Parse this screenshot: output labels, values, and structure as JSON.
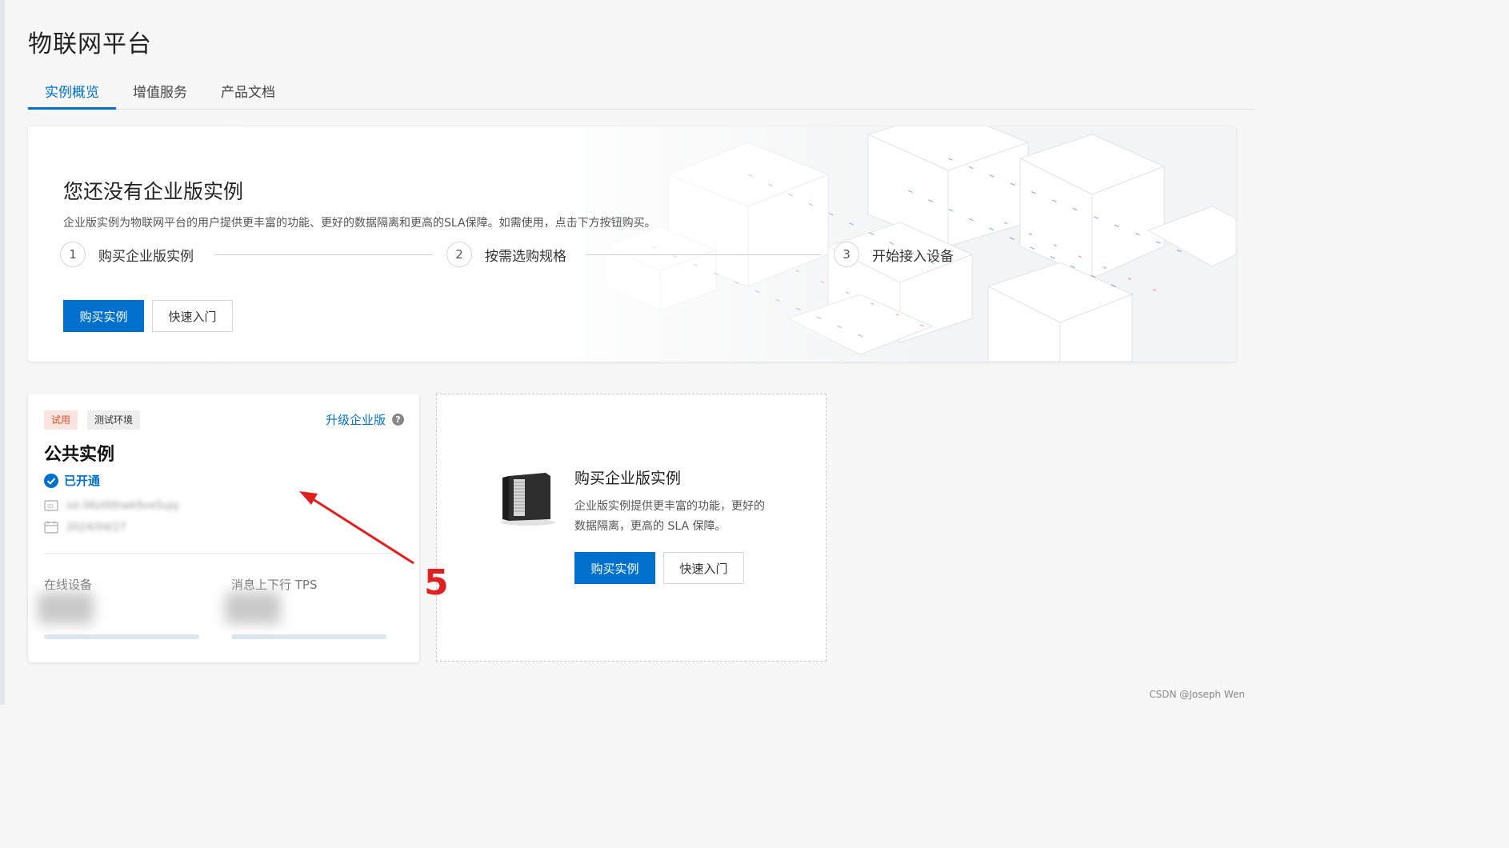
{
  "page": {
    "title": "物联网平台"
  },
  "tabs": [
    {
      "label": "实例概览",
      "active": true
    },
    {
      "label": "增值服务",
      "active": false
    },
    {
      "label": "产品文档",
      "active": false
    }
  ],
  "banner": {
    "title": "您还没有企业版实例",
    "description": "企业版实例为物联网平台的用户提供更丰富的功能、更好的数据隔离和更高的SLA保障。如需使用，点击下方按钮购买。",
    "steps": [
      {
        "num": "1",
        "label": "购买企业版实例"
      },
      {
        "num": "2",
        "label": "按需选购规格"
      },
      {
        "num": "3",
        "label": "开始接入设备"
      }
    ],
    "buy_button": "购买实例",
    "quickstart_button": "快速入门"
  },
  "instance_card": {
    "tags": {
      "trial": "试用",
      "env": "测试环境"
    },
    "upgrade_link": "升级企业版",
    "help_icon": "?",
    "title": "公共实例",
    "status": "已开通",
    "instance_id": "iot-06z00hwk9ve5ujq",
    "created_date": "2024/04/27",
    "metrics": {
      "online_devices_label": "在线设备",
      "tps_label": "消息上下行 TPS"
    }
  },
  "buy_card": {
    "title": "购买企业版实例",
    "description": "企业版实例提供更丰富的功能，更好的数据隔离，更高的 SLA 保障。",
    "buy_button": "购买实例",
    "quickstart_button": "快速入门"
  },
  "annotation": {
    "label": "5",
    "color": "#e02020"
  },
  "watermark": "CSDN @Joseph Wen",
  "colors": {
    "primary": "#0070cc",
    "trial_tag": "#d9542b"
  }
}
